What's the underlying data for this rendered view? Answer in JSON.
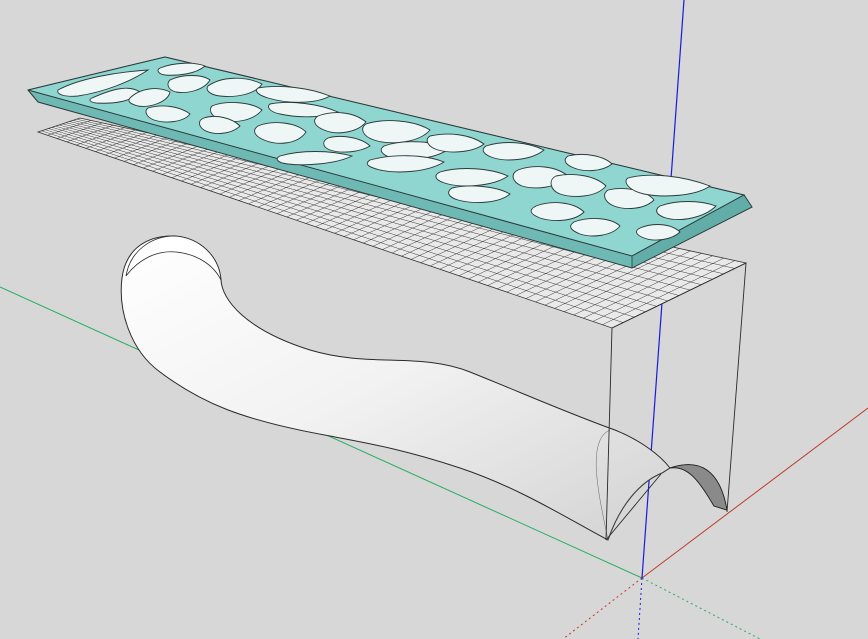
{
  "app": {
    "viewport_label": ""
  },
  "scene": {
    "background_color": "#d7d7d7",
    "panel_color": "#8fd6d0",
    "panel_edge_color": "#2b3a3a",
    "hole_face_color": "#eef6f6",
    "mesh_color": "#2a2a2a",
    "surface_color": "#f4f4f4",
    "axis_colors": {
      "red": "#c0392b",
      "green": "#27ae60",
      "blue": "#1a1adf"
    }
  },
  "objects": [
    {
      "name": "perforated-panel",
      "kind": "voronoi-cutout-plate"
    },
    {
      "name": "grid-mesh",
      "kind": "rectangular-grid"
    },
    {
      "name": "curved-surface",
      "kind": "swept-arch-surface"
    },
    {
      "name": "bounding-frame",
      "kind": "vertical-projection-lines"
    }
  ]
}
